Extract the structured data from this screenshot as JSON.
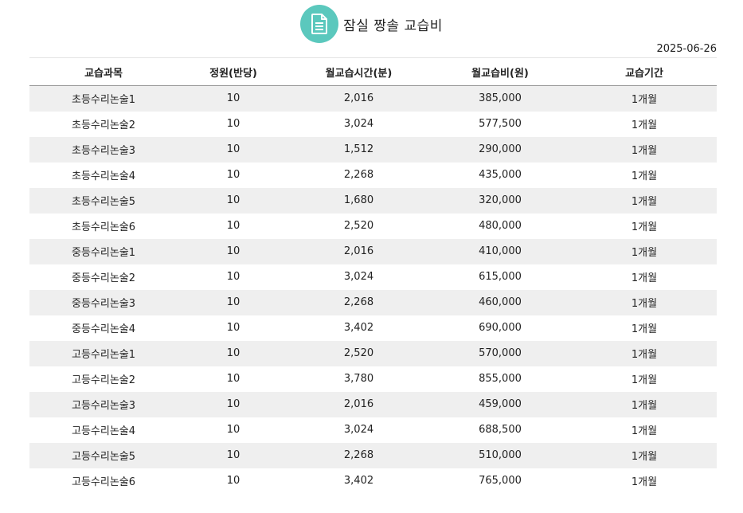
{
  "header": {
    "title": "잠실 짱솔 교습비",
    "icon": "document-icon",
    "icon_color": "#5bc8bd"
  },
  "date": "2025-06-26",
  "table": {
    "columns": [
      "교습과목",
      "정원(반당)",
      "월교습시간(분)",
      "월교습비(원)",
      "교습기간"
    ],
    "rows": [
      [
        "초등수리논술1",
        "10",
        "2,016",
        "385,000",
        "1개월"
      ],
      [
        "초등수리논술2",
        "10",
        "3,024",
        "577,500",
        "1개월"
      ],
      [
        "초등수리논술3",
        "10",
        "1,512",
        "290,000",
        "1개월"
      ],
      [
        "초등수리논술4",
        "10",
        "2,268",
        "435,000",
        "1개월"
      ],
      [
        "초등수리논술5",
        "10",
        "1,680",
        "320,000",
        "1개월"
      ],
      [
        "초등수리논술6",
        "10",
        "2,520",
        "480,000",
        "1개월"
      ],
      [
        "중등수리논술1",
        "10",
        "2,016",
        "410,000",
        "1개월"
      ],
      [
        "중등수리논술2",
        "10",
        "3,024",
        "615,000",
        "1개월"
      ],
      [
        "중등수리논술3",
        "10",
        "2,268",
        "460,000",
        "1개월"
      ],
      [
        "중등수리논술4",
        "10",
        "3,402",
        "690,000",
        "1개월"
      ],
      [
        "고등수리논술1",
        "10",
        "2,520",
        "570,000",
        "1개월"
      ],
      [
        "고등수리논술2",
        "10",
        "3,780",
        "855,000",
        "1개월"
      ],
      [
        "고등수리논술3",
        "10",
        "2,016",
        "459,000",
        "1개월"
      ],
      [
        "고등수리논술4",
        "10",
        "3,024",
        "688,500",
        "1개월"
      ],
      [
        "고등수리논술5",
        "10",
        "2,268",
        "510,000",
        "1개월"
      ],
      [
        "고등수리논술6",
        "10",
        "3,402",
        "765,000",
        "1개월"
      ]
    ]
  }
}
